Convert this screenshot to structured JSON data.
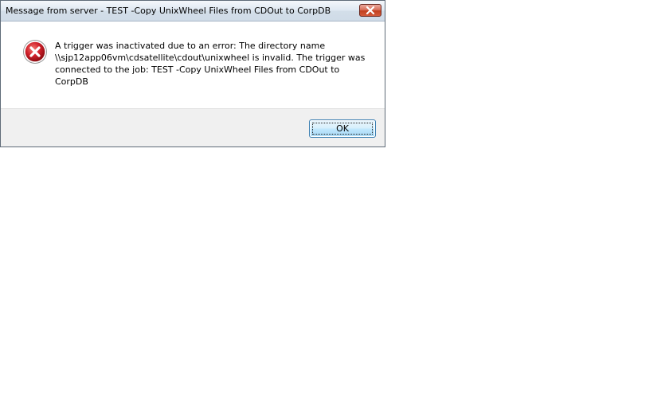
{
  "dialog": {
    "title": "Message from server - TEST -Copy UnixWheel Files from CDOut to CorpDB",
    "close_icon": "close-icon",
    "error_icon": "error-icon",
    "message_lines": [
      "A trigger was inactivated due to an error: The directory name",
      "\\\\sjp12app06vm\\cdsatellite\\cdout\\unixwheel is invalid. The trigger was",
      "connected to the job: TEST -Copy UnixWheel Files from CDOut to",
      "CorpDB"
    ],
    "ok_label": "OK"
  },
  "colors": {
    "close_button": "#c2401f",
    "error_icon": "#d0202a",
    "ok_button_border": "#3c7fb1",
    "footer_background": "#f0f0f0"
  }
}
